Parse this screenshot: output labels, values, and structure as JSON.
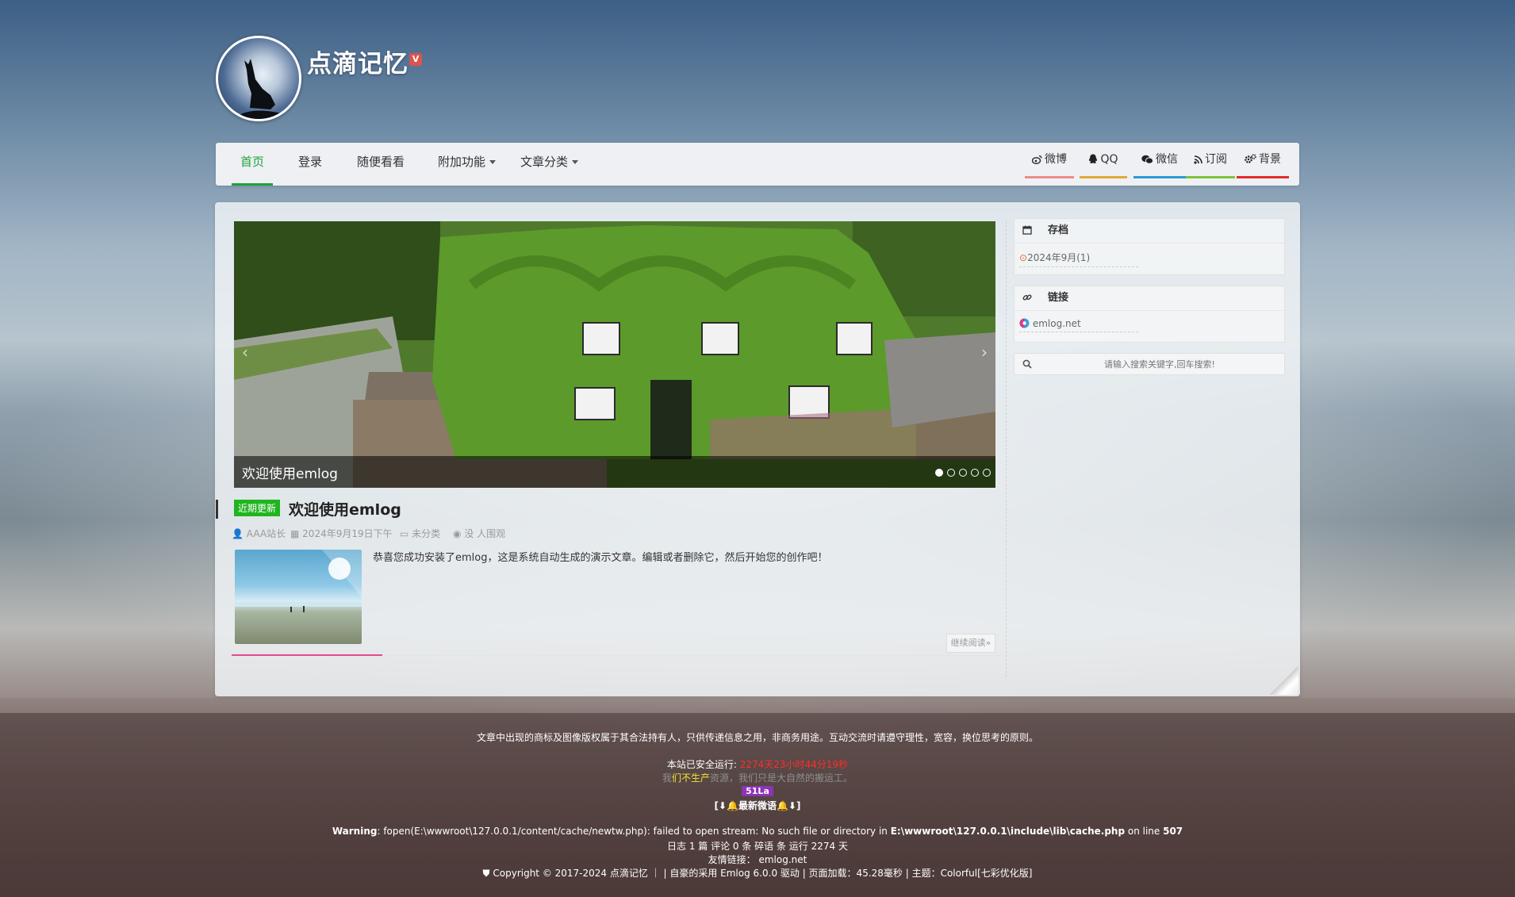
{
  "site": {
    "title": "点滴记忆",
    "badge": "V"
  },
  "nav": {
    "items": [
      {
        "label": "首页",
        "active": true
      },
      {
        "label": "登录"
      },
      {
        "label": "随便看看"
      },
      {
        "label": "附加功能"
      },
      {
        "label": "文章分类"
      }
    ],
    "social": [
      {
        "label": "微博",
        "icon": "weibo-icon",
        "color": "#ee8a8a"
      },
      {
        "label": "QQ",
        "icon": "qq-icon",
        "color": "#e2a93b"
      },
      {
        "label": "微信",
        "icon": "wechat-icon",
        "color": "#2a9bd6"
      },
      {
        "label": "订阅",
        "icon": "rss-icon",
        "color": "#7cc33a"
      },
      {
        "label": "背景",
        "icon": "gears-icon",
        "color": "#e02b2b"
      }
    ]
  },
  "slider": {
    "caption": "欢迎使用emlog",
    "slides": 5,
    "active": 0
  },
  "post": {
    "tag": "近期更新",
    "title": "欢迎使用emlog",
    "author": "AAA站长",
    "date": "2024年9月19日下午",
    "category": "未分类",
    "views": "没 人围观",
    "excerpt": "恭喜您成功安装了emlog，这是系统自动生成的演示文章。编辑或者删除它，然后开始您的创作吧！",
    "readmore": "继续阅读»"
  },
  "sidebar": {
    "archive": {
      "title": "存档",
      "entry": "2024年9月(1)"
    },
    "links": {
      "title": "链接",
      "entry": "emlog.net"
    },
    "search": {
      "placeholder": "请输入搜索关键字,回车搜索!"
    }
  },
  "footer": {
    "notice": "文章中出现的商标及图像版权属于其合法持有人，只供传递信息之用，非商务用途。互动交流时请遵守理性，宽容，换位思考的原则。",
    "runtime_label": "本站已安全运行:",
    "runtime_value": "2274天23小时44分19秒",
    "slogan_1": "我",
    "slogan_2": "们不生产",
    "slogan_3": "资源，我们只是大自然的搬运工。",
    "la_badge": "51La",
    "weiyu": "[⬇🔔最新微语🔔⬇]",
    "warning_bold": "Warning",
    "warning_text": ": fopen(E:\\wwwroot\\127.0.0.1/content/cache/newtw.php): failed to open stream: No such file or directory in ",
    "warning_path": "E:\\wwwroot\\127.0.0.1\\include\\lib\\cache.php",
    "warning_online": " on line ",
    "warning_line": "507",
    "stats": "日志 1 篇 评论 0 条 碎语 条 运行 2274 天",
    "friends_label": "友情链接：",
    "friends_link": "emlog.net",
    "copyright": "Copyright © 2017-2024 点滴记忆 ｜ | 自豪的采用 Emlog 6.0.0 驱动 | 页面加载：45.28毫秒 | 主题：Colorful[七彩优化版]"
  }
}
